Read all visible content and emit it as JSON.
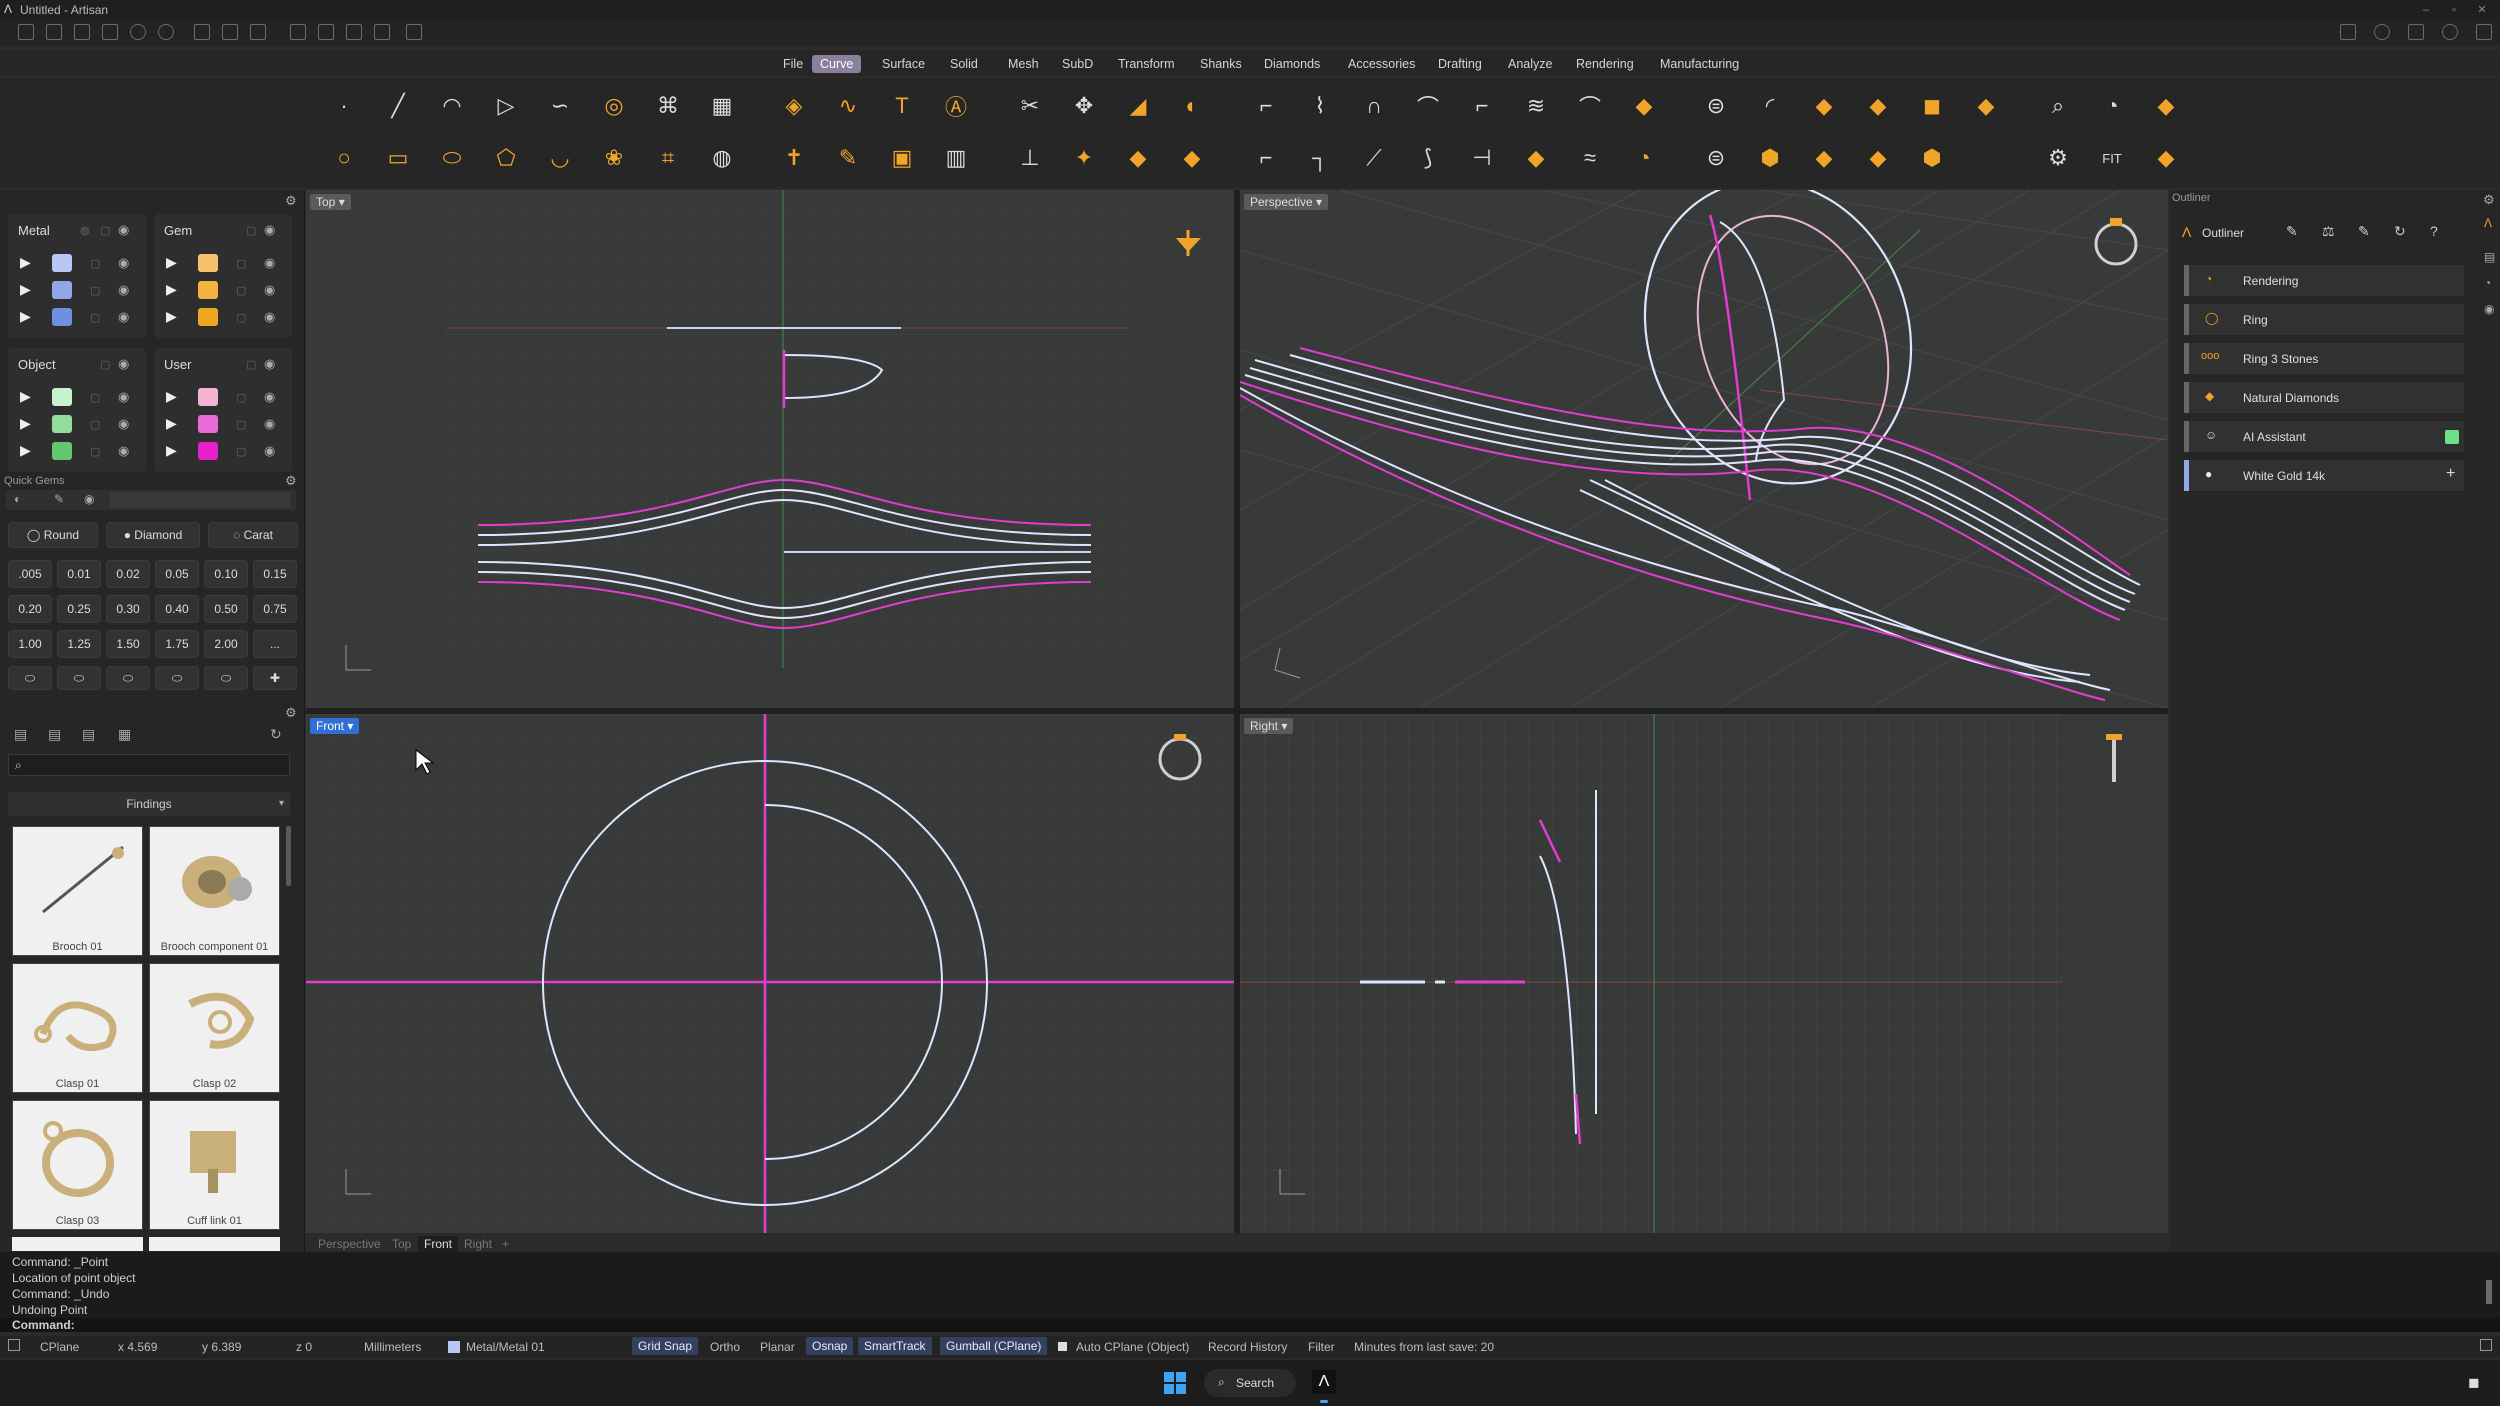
{
  "app": {
    "title": "Untitled - Artisan"
  },
  "menu": {
    "items": [
      "File",
      "Curve",
      "Surface",
      "Solid",
      "Mesh",
      "SubD",
      "Transform",
      "Shanks",
      "Diamonds",
      "Accessories",
      "Drafting",
      "Analyze",
      "Rendering",
      "Manufacturing"
    ],
    "active": "Curve"
  },
  "layers": {
    "metal": {
      "title": "Metal",
      "colors": [
        "#b7c8f6",
        "#8fa8e8",
        "#6f8fe0"
      ]
    },
    "gem": {
      "title": "Gem",
      "colors": [
        "#f5c46a",
        "#f2b340",
        "#efa71f"
      ]
    },
    "object": {
      "title": "Object",
      "colors": [
        "#c9f2cf",
        "#92df9c",
        "#62c870"
      ]
    },
    "user": {
      "title": "User",
      "colors": [
        "#f5b3d1",
        "#ea6bd8",
        "#e81fcc"
      ]
    }
  },
  "quickgems": {
    "title": "Quick Gems",
    "shape": "Round",
    "material": "Diamond",
    "unit": "Carat",
    "sizes": [
      ".005",
      "0.01",
      "0.02",
      "0.05",
      "0.10",
      "0.15",
      "0.20",
      "0.25",
      "0.30",
      "0.40",
      "0.50",
      "0.75",
      "1.00",
      "1.25",
      "1.50",
      "1.75",
      "2.00",
      "..."
    ]
  },
  "library": {
    "category": "Findings",
    "items": [
      "Brooch 01",
      "Brooch component 01",
      "Clasp 01",
      "Clasp 02",
      "Clasp 03",
      "Cuff link 01"
    ]
  },
  "viewports": {
    "top": "Top",
    "perspective": "Perspective",
    "front": "Front",
    "right": "Right"
  },
  "viewport_tabs": [
    "Perspective",
    "Top",
    "Front",
    "Right",
    "+"
  ],
  "outliner": {
    "panel_title": "Outliner",
    "tab": "Outliner",
    "items": [
      "Rendering",
      "Ring",
      "Ring 3 Stones",
      "Natural Diamonds",
      "AI Assistant",
      "White Gold 14k"
    ]
  },
  "command": {
    "history": [
      "Command: _Point",
      "Location of point object",
      "Command: _Undo",
      "Undoing Point"
    ],
    "prompt": "Command:"
  },
  "status": {
    "cplane": "CPlane",
    "x": "x 4.569",
    "y": "y 6.389",
    "z": "z 0",
    "units": "Millimeters",
    "layer": "Metal/Metal 01",
    "toggles": [
      "Grid Snap",
      "Ortho",
      "Planar",
      "Osnap",
      "SmartTrack",
      "Gumball (CPlane)"
    ],
    "auto_cplane": "Auto CPlane (Object)",
    "record": "Record History",
    "filter": "Filter",
    "save": "Minutes from last save: 20"
  },
  "taskbar": {
    "search": "Search"
  }
}
